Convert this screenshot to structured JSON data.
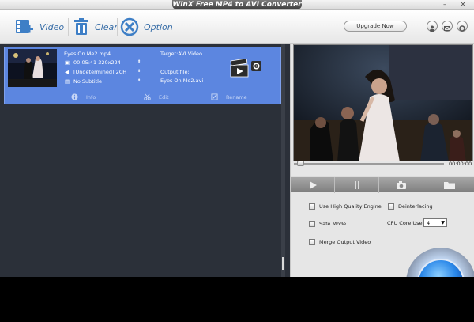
{
  "window": {
    "title": "WinX Free MP4 to AVI Converter"
  },
  "toolbar": {
    "video_label": "Video",
    "clear_label": "Clear",
    "option_label": "Option",
    "upgrade_label": "Upgrade Now"
  },
  "item": {
    "filename": "Eyes On Me2.mp4",
    "target": "Target:AVI Video",
    "duration_res": "00:05:41  320x224",
    "audio": "[Undetermined] 2CH",
    "subtitle": "No Subtitle",
    "output_label": "Output file:",
    "output_name": "Eyes On Me2.avi",
    "actions": {
      "info": "Info",
      "edit": "Edit",
      "rename": "Rename"
    }
  },
  "player": {
    "time": "00:00:00",
    "progress": 0
  },
  "options": {
    "high_quality": "Use High Quality Engine",
    "deinterlacing": "Deinterlacing",
    "safe_mode": "Safe Mode",
    "cpu_label": "CPU Core Use:",
    "cpu_value": "4",
    "merge": "Merge Output Video"
  },
  "colors": {
    "accent": "#5c86e0",
    "panel": "#2b3039",
    "toolbar_text": "#3a6fa8"
  }
}
